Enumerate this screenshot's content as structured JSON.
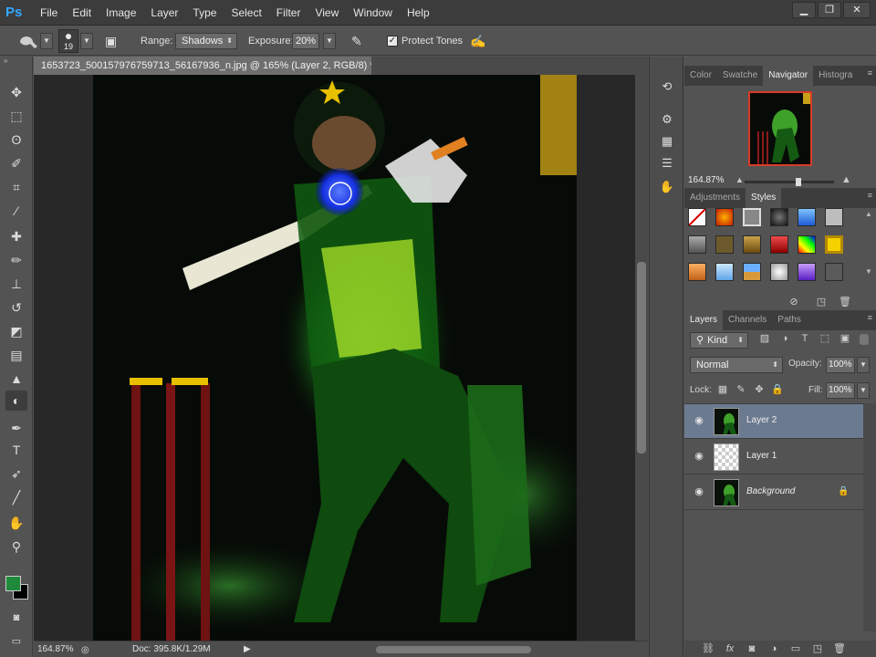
{
  "app": {
    "logo": "Ps"
  },
  "menu": [
    "File",
    "Edit",
    "Image",
    "Layer",
    "Type",
    "Select",
    "Filter",
    "View",
    "Window",
    "Help"
  ],
  "window_controls": {
    "minimize": "▁",
    "restore": "❐",
    "close": "✕"
  },
  "options": {
    "brush_size": "19",
    "range_label": "Range:",
    "range_value": "Shadows",
    "exposure_label": "Exposure:",
    "exposure_value": "20%",
    "protect_tones_label": "Protect Tones",
    "protect_tones_checked": true
  },
  "tools": [
    "move-icon",
    "marquee-icon",
    "lasso-icon",
    "quick-select-icon",
    "crop-icon",
    "eyedropper-icon",
    "healing-icon",
    "brush-icon",
    "stamp-icon",
    "history-brush-icon",
    "eraser-icon",
    "gradient-icon",
    "blur-icon",
    "dodge-burn-icon",
    "pen-icon",
    "type-icon",
    "path-select-icon",
    "line-icon",
    "hand-icon",
    "zoom-icon"
  ],
  "colors": {
    "foreground": "#1f8a3b",
    "background": "#000000",
    "accent_selection": "#6b7a8f"
  },
  "document": {
    "tab_title": "1653723_500157976759713_56167936_n.jpg @ 165% (Layer 2, RGB/8) *",
    "tab_close": "×",
    "status_zoom": "164.87%",
    "status_doc": "Doc: 395.8K/1.29M"
  },
  "panels": {
    "top_tabs": [
      "Color",
      "Swatche",
      "Navigator",
      "Histogra"
    ],
    "top_active": "Navigator",
    "navigator_zoom": "164.87%",
    "mid_tabs": [
      "Adjustments",
      "Styles"
    ],
    "mid_active": "Styles",
    "layers_tabs": [
      "Layers",
      "Channels",
      "Paths"
    ],
    "layers_active": "Layers",
    "kind_label": "Kind",
    "blend_mode": "Normal",
    "opacity_label": "Opacity:",
    "opacity_value": "100%",
    "lock_label": "Lock:",
    "fill_label": "Fill:",
    "fill_value": "100%",
    "layers": [
      {
        "name": "Layer 2",
        "selected": true,
        "italic": false
      },
      {
        "name": "Layer 1",
        "selected": false,
        "italic": false
      },
      {
        "name": "Background",
        "selected": false,
        "italic": true
      }
    ]
  }
}
